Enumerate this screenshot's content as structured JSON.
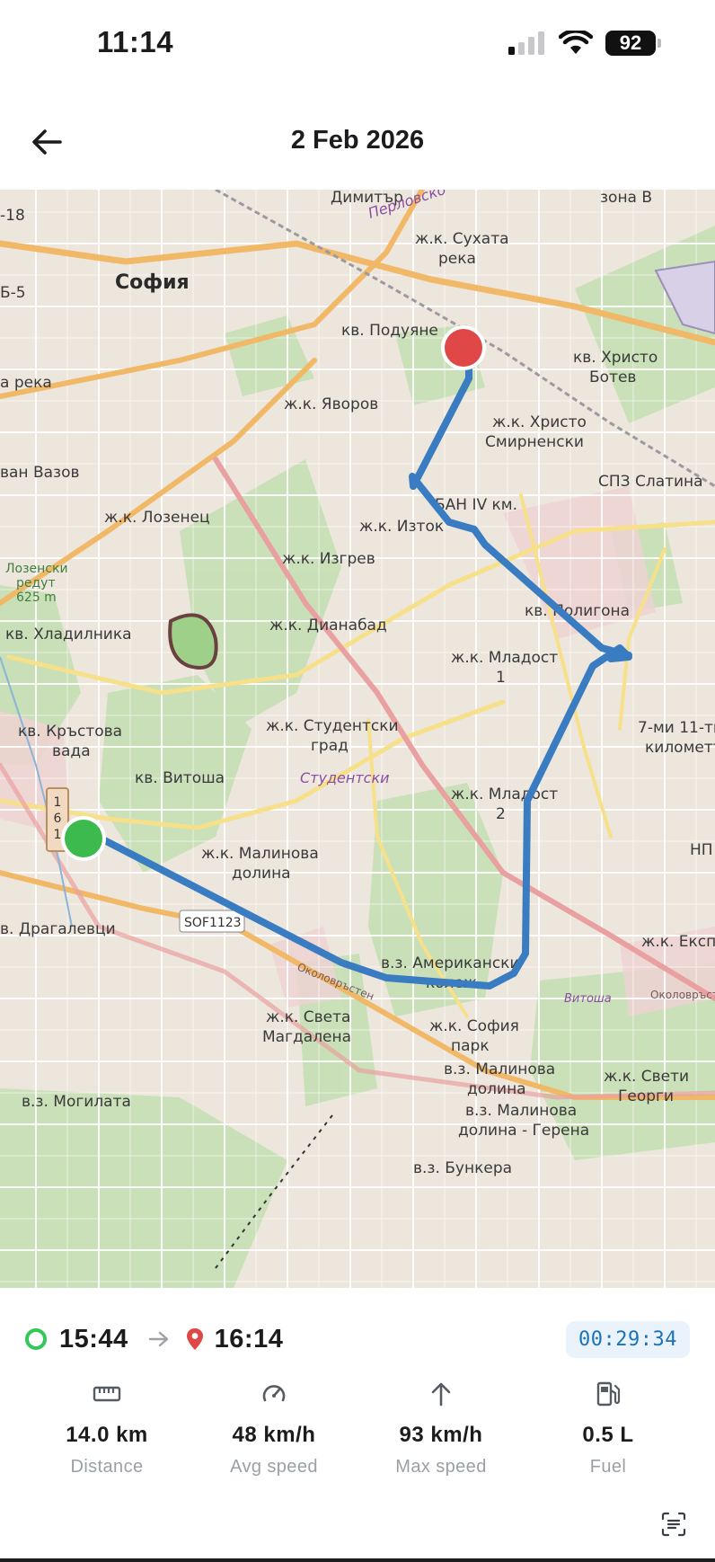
{
  "status_bar": {
    "time": "11:14",
    "battery": "92"
  },
  "header": {
    "title": "2 Feb 2026",
    "back_icon": "arrow-left-icon"
  },
  "map": {
    "labels": {
      "dimitar": "Димитър",
      "zona_b": "зона В",
      "perlovsko": "Перловско",
      "sukhata_reka_1": "ж.к. Сухата",
      "sukhata_reka_2": "река",
      "sofia": "София",
      "b5": "Б-5",
      "b18": "-18",
      "poduyane": "кв. Подуяне",
      "hristo_botev_1": "кв. Христо",
      "hristo_botev_2": "Ботев",
      "reka": "а река",
      "yavorov": "ж.к. Яворов",
      "hristo_smirnenski_1": "ж.к. Христо",
      "hristo_smirnenski_2": "Смирненски",
      "vazov": "ван Вазов",
      "spz_slatina": "СПЗ Слатина",
      "ban": "БАН IV км.",
      "lozenets": "ж.к. Лозенец",
      "iztok": "ж.к. Изток",
      "izgrev": "ж.к. Изгрев",
      "redut_1": "Лозенски",
      "redut_2": "редут",
      "redut_3": "625 m",
      "poligona": "кв. Полигона",
      "hladilnika": "кв. Хладилника",
      "dianabad": "ж.к. Дианабад",
      "mladost1_1": "ж.к. Младост",
      "mladost1_2": "1",
      "krastova_1": "кв. Кръстова",
      "krastova_2": "вада",
      "studentski_1": "ж.к. Студентски",
      "studentski_2": "град",
      "studentski_purple": "Студентски",
      "km11_1": "7-ми 11-ти",
      "km11_2": "километър",
      "vitosha": "кв. Витоша",
      "mladost2_1": "ж.к. Младост",
      "mladost2_2": "2",
      "np": "НП",
      "malinova_1": "ж.к. Малинова",
      "malinova_2": "долина",
      "dragalevtsi": "в. Драгалевци",
      "sof": "SOF1123",
      "ekspo": "ж.к. Експо",
      "amerikanski_1": "в.з. Американски",
      "amerikanski_2": "колеж",
      "okolovrasten": "Околовръстен",
      "sveta_magdalena_1": "ж.к. Света",
      "sveta_magdalena_2": "Магдалена",
      "sofia_park_1": "ж.к. София",
      "sofia_park_2": "парк",
      "vitosha_road": "Витоша",
      "mogilata": "в.з. Могилата",
      "vz_malinova_1": "в.з. Малинова",
      "vz_malinova_2": "долина",
      "sveti_georgi_1": "ж.к. Свети",
      "sveti_georgi_2": "Георги",
      "gerena_1": "в.з. Малинова",
      "gerena_2": "долина - Герена",
      "bunkera": "в.з. Бункера",
      "route_label": "1 6 1"
    }
  },
  "trip": {
    "start_time": "15:44",
    "end_time": "16:14",
    "duration": "00:29:34"
  },
  "stats": [
    {
      "icon": "ruler-icon",
      "value": "14.0 km",
      "label": "Distance"
    },
    {
      "icon": "speedometer-icon",
      "value": "48 km/h",
      "label": "Avg speed"
    },
    {
      "icon": "arrow-up-icon",
      "value": "93 km/h",
      "label": "Max speed"
    },
    {
      "icon": "fuel-pump-icon",
      "value": "0.5 L",
      "label": "Fuel"
    }
  ],
  "colors": {
    "route": "#3a7cc1",
    "start_marker": "#3dba4e",
    "end_marker": "#e04848",
    "accent": "#1a73b8"
  }
}
